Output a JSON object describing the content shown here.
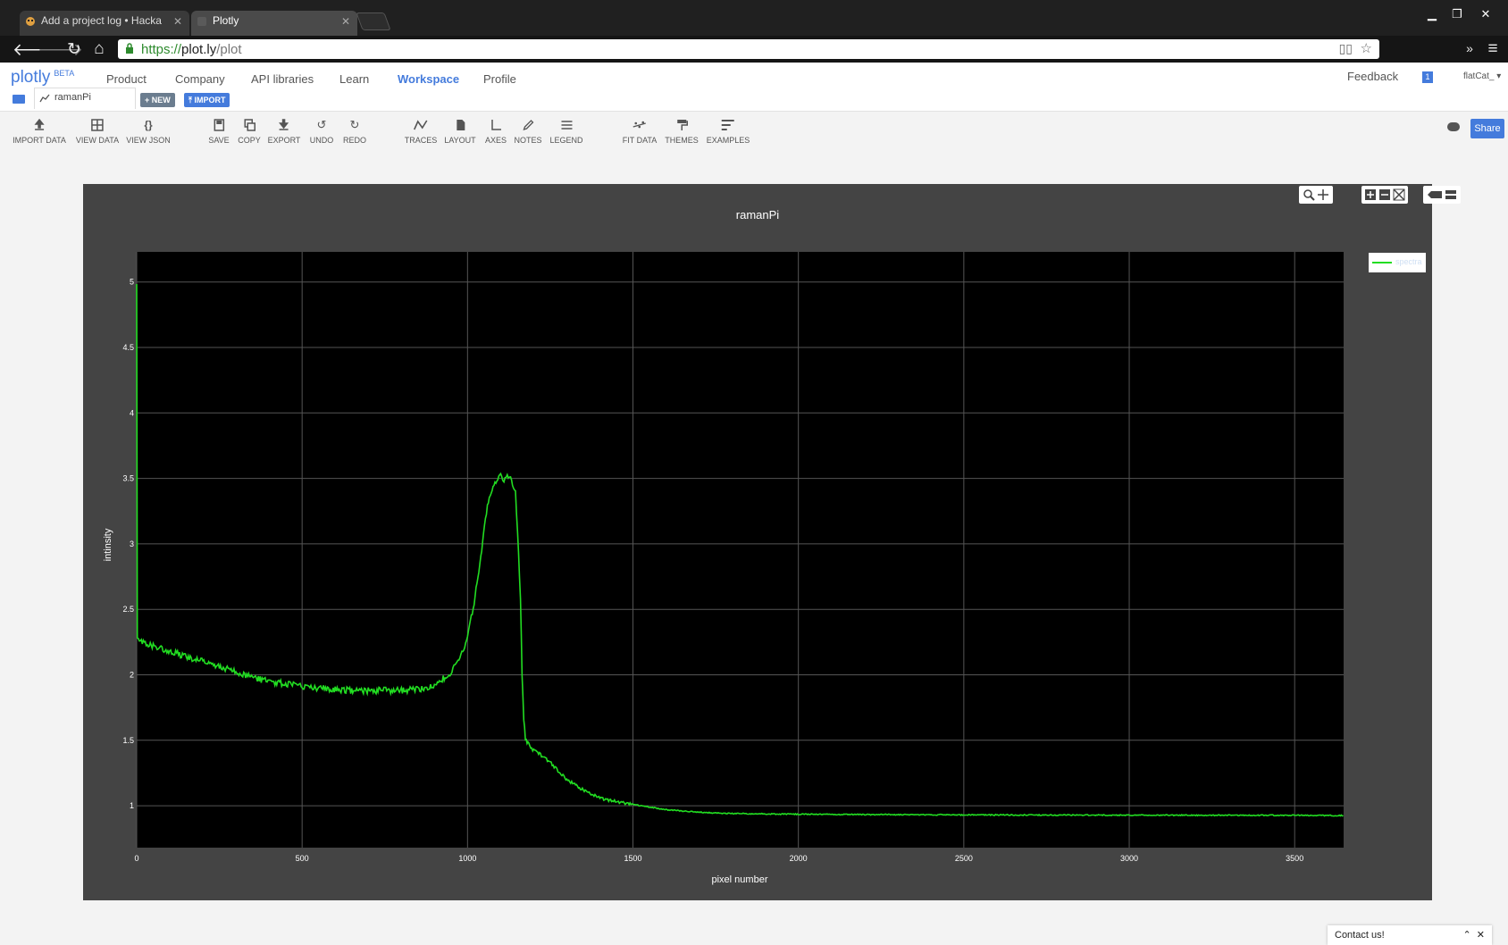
{
  "browser": {
    "tabs": [
      {
        "title": "Add a project log • Hacka",
        "active": false
      },
      {
        "title": "Plotly",
        "active": true
      }
    ],
    "url_scheme": "https://",
    "url_host": "plot.ly",
    "url_path": "/plot"
  },
  "header": {
    "logo": "plotly",
    "logo_badge": "BETA",
    "nav": [
      "Product",
      "Company",
      "API libraries",
      "Learn",
      "Workspace",
      "Profile"
    ],
    "active_nav": "Workspace",
    "feedback": "Feedback",
    "notifications": "1",
    "user": "flatCat_",
    "file_tab": "ramanPi",
    "new_button": "NEW",
    "import_button": "IMPORT"
  },
  "toolbar": {
    "tools": [
      {
        "label": "IMPORT DATA",
        "icon": "upload-icon"
      },
      {
        "label": "VIEW DATA",
        "icon": "grid-icon"
      },
      {
        "label": "VIEW JSON",
        "icon": "braces-icon"
      },
      {
        "label": "SAVE",
        "icon": "floppy-icon"
      },
      {
        "label": "COPY",
        "icon": "copy-icon"
      },
      {
        "label": "EXPORT",
        "icon": "download-icon"
      },
      {
        "label": "UNDO",
        "icon": "undo-icon"
      },
      {
        "label": "REDO",
        "icon": "redo-icon"
      },
      {
        "label": "TRACES",
        "icon": "traces-icon"
      },
      {
        "label": "LAYOUT",
        "icon": "document-icon"
      },
      {
        "label": "AXES",
        "icon": "axes-icon"
      },
      {
        "label": "NOTES",
        "icon": "pencil-icon"
      },
      {
        "label": "LEGEND",
        "icon": "list-icon"
      },
      {
        "label": "FIT DATA",
        "icon": "fit-icon"
      },
      {
        "label": "THEMES",
        "icon": "paint-roller-icon"
      },
      {
        "label": "EXAMPLES",
        "icon": "bars-icon"
      }
    ],
    "share": "Share"
  },
  "chart_data": {
    "type": "line",
    "title": "ramanPi",
    "xlabel": "pixel number",
    "ylabel": "intinsity",
    "xlim": [
      0,
      3648
    ],
    "ylim": [
      0.68,
      5.23
    ],
    "xticks": [
      0,
      500,
      1000,
      1500,
      2000,
      2500,
      3000,
      3500
    ],
    "yticks": [
      1,
      1.5,
      2,
      2.5,
      3,
      3.5,
      4,
      4.5,
      5
    ],
    "grid": true,
    "legend_position": "top-right",
    "colors": {
      "line": "#22dd22",
      "plot_bg": "#000000",
      "paper_bg": "#444444",
      "grid": "#555555"
    },
    "series": [
      {
        "name": "spectra",
        "x": [
          0,
          2,
          5,
          50,
          100,
          150,
          200,
          250,
          300,
          350,
          400,
          450,
          500,
          550,
          600,
          650,
          700,
          750,
          800,
          850,
          900,
          950,
          980,
          1000,
          1020,
          1040,
          1060,
          1080,
          1100,
          1110,
          1120,
          1130,
          1145,
          1160,
          1165,
          1170,
          1175,
          1180,
          1185,
          1200,
          1250,
          1300,
          1350,
          1400,
          1450,
          1500,
          1550,
          1600,
          1650,
          1700,
          1800,
          2000,
          2500,
          3000,
          3500,
          3647
        ],
        "y": [
          5.0,
          2.28,
          2.26,
          2.22,
          2.18,
          2.14,
          2.1,
          2.06,
          2.02,
          1.98,
          1.95,
          1.93,
          1.91,
          1.9,
          1.89,
          1.88,
          1.88,
          1.88,
          1.88,
          1.89,
          1.92,
          2.02,
          2.14,
          2.3,
          2.55,
          2.9,
          3.3,
          3.45,
          3.52,
          3.47,
          3.52,
          3.5,
          3.4,
          2.6,
          2.0,
          1.65,
          1.52,
          1.48,
          1.46,
          1.43,
          1.33,
          1.2,
          1.12,
          1.06,
          1.03,
          1.01,
          0.99,
          0.97,
          0.96,
          0.95,
          0.94,
          0.935,
          0.93,
          0.928,
          0.927,
          0.925
        ]
      }
    ]
  },
  "contact": {
    "label": "Contact us!"
  }
}
